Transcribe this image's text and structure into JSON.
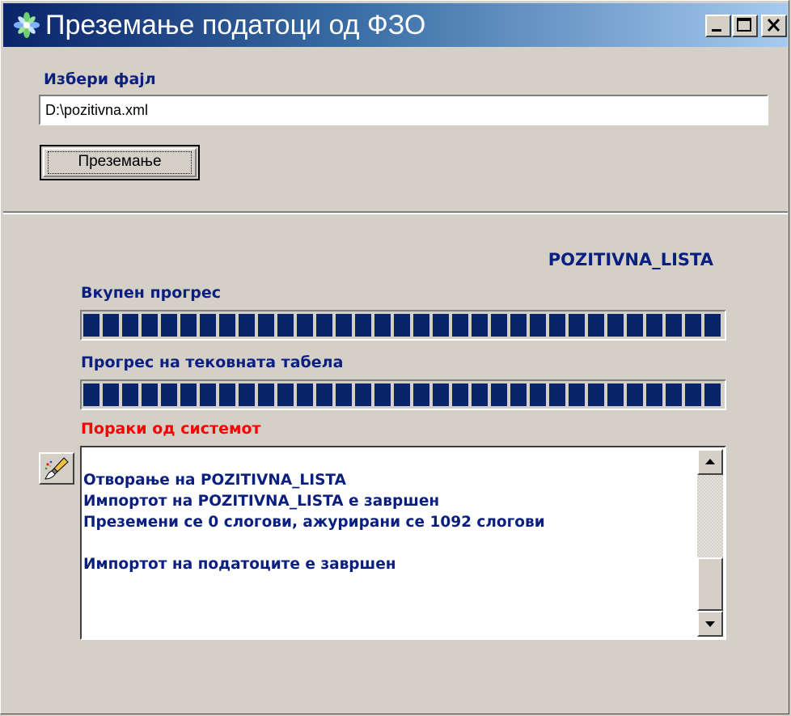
{
  "window": {
    "title": "Преземање податоци од ФЗО",
    "controls": {
      "minimize": "minimize",
      "maximize": "maximize",
      "close": "close"
    }
  },
  "file": {
    "label": "Избери фајл",
    "value": "D:\\pozitivna.xml"
  },
  "import_button": {
    "label": "Преземање"
  },
  "current_table": "POZITIVNA_LISTA",
  "progress": {
    "overall": {
      "label": "Вкупен прогрес",
      "percent": 100
    },
    "table": {
      "label": "Прогрес на тековната табела",
      "percent": 100
    }
  },
  "messages": {
    "label": "Пораки од системот",
    "lines": [
      "Отворање на POZITIVNA_LISTA",
      "Импортот на POZITIVNA_LISTA е завршен",
      "Преземени се 0 слогови, ажурирани се 1092 слогови",
      "",
      "Импортот на податоците е завршен"
    ]
  },
  "icons": {
    "app": "app-flower-icon",
    "clear": "eraser-brush-icon"
  },
  "colors": {
    "label_blue": "#0a1f80",
    "error_red": "#ff0000",
    "progress_fill": "#0a246a",
    "titlebar_start": "#0a246a",
    "titlebar_end": "#a6caf0"
  }
}
